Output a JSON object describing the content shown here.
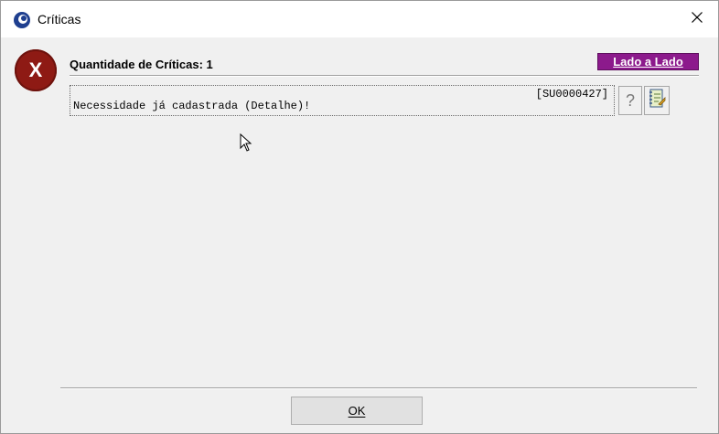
{
  "window": {
    "title": "Críticas",
    "app_icon": "app-logo-icon",
    "close_icon": "close-icon"
  },
  "dialog": {
    "status_icon": "error-x-icon",
    "status_icon_letter": "X",
    "status_color": "#8e1a14",
    "count_label": "Quantidade de Críticas: 1",
    "side_by_side_label": "Lado a Lado",
    "side_by_side_color": "#8c1a8c"
  },
  "messages": [
    {
      "code": "[SU0000427]",
      "text": "Necessidade já cadastrada (Detalhe)!",
      "help_label": "?",
      "help_icon": "help-icon",
      "notes_icon": "notepad-icon"
    }
  ],
  "footer": {
    "ok_label": "OK"
  }
}
